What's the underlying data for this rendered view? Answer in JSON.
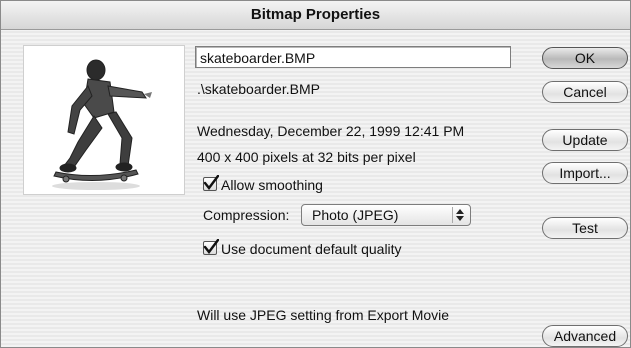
{
  "window": {
    "title": "Bitmap Properties"
  },
  "file": {
    "name": "skateboarder.BMP",
    "path": ".\\skateboarder.BMP",
    "date": "Wednesday, December 22, 1999  12:41 PM",
    "dimensions": "400 x 400 pixels at 32 bits per pixel"
  },
  "options": {
    "allow_smoothing_label": "Allow smoothing",
    "allow_smoothing_checked": true,
    "compression_label": "Compression:",
    "compression_value": "Photo (JPEG)",
    "use_default_quality_label": "Use document default quality",
    "use_default_quality_checked": true,
    "note": "Will use JPEG setting from Export Movie"
  },
  "buttons": {
    "ok": "OK",
    "cancel": "Cancel",
    "update": "Update",
    "import": "Import...",
    "test": "Test",
    "advanced": "Advanced"
  },
  "icons": {
    "preview": "skateboarder-thumbnail",
    "checkbox": "checkmark-icon",
    "select_arrows": "up-down-arrows-icon"
  }
}
